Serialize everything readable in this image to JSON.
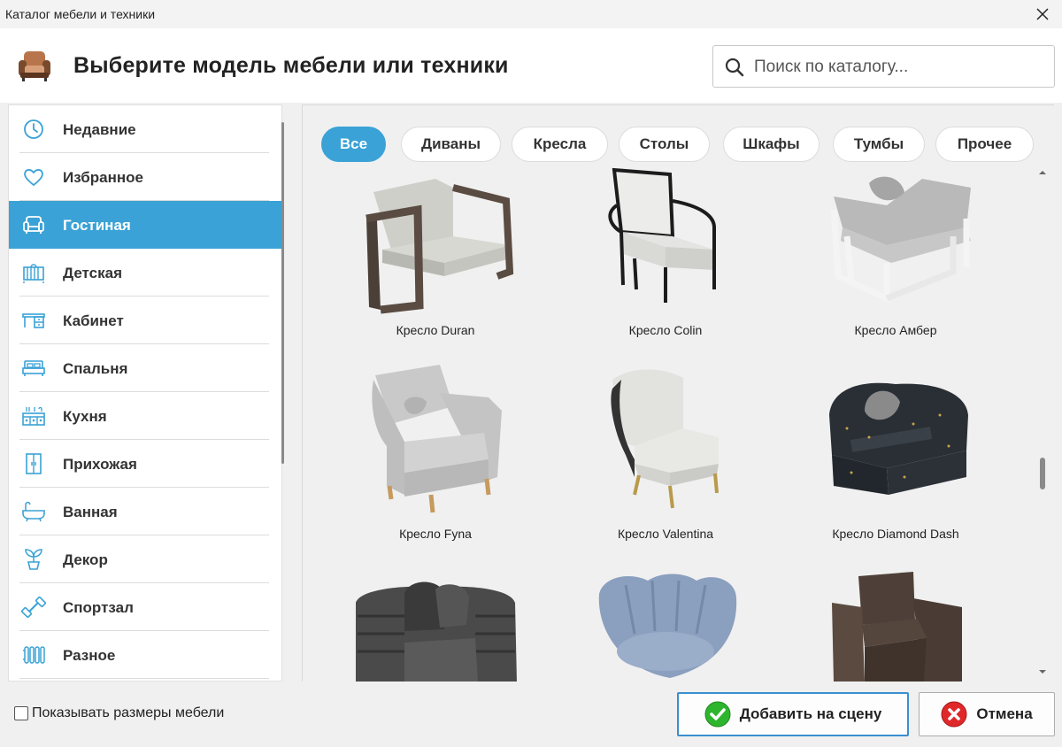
{
  "window": {
    "title": "Каталог мебели и техники"
  },
  "header": {
    "heading": "Выберите модель мебели или техники"
  },
  "search": {
    "placeholder": "Поиск по каталогу..."
  },
  "sidebar": {
    "items": [
      {
        "label": "Недавние",
        "icon": "clock-icon"
      },
      {
        "label": "Избранное",
        "icon": "heart-icon"
      },
      {
        "label": "Гостиная",
        "icon": "sofa-icon",
        "active": true
      },
      {
        "label": "Детская",
        "icon": "crib-icon"
      },
      {
        "label": "Кабинет",
        "icon": "desk-icon"
      },
      {
        "label": "Спальня",
        "icon": "bed-icon"
      },
      {
        "label": "Кухня",
        "icon": "kitchen-icon"
      },
      {
        "label": "Прихожая",
        "icon": "wardrobe-icon"
      },
      {
        "label": "Ванная",
        "icon": "bathtub-icon"
      },
      {
        "label": "Декор",
        "icon": "plant-icon"
      },
      {
        "label": "Спортзал",
        "icon": "dumbbell-icon"
      },
      {
        "label": "Разное",
        "icon": "radiator-icon"
      }
    ]
  },
  "filters": [
    {
      "label": "Все",
      "active": true
    },
    {
      "label": "Диваны"
    },
    {
      "label": "Кресла"
    },
    {
      "label": "Столы"
    },
    {
      "label": "Шкафы"
    },
    {
      "label": "Тумбы"
    },
    {
      "label": "Прочее"
    }
  ],
  "items": [
    {
      "name": "Кресло Duran"
    },
    {
      "name": "Кресло Colin"
    },
    {
      "name": "Кресло Амбер"
    },
    {
      "name": "Кресло Fyna"
    },
    {
      "name": "Кресло Valentina"
    },
    {
      "name": "Кресло Diamond Dash"
    },
    {
      "name": ""
    },
    {
      "name": ""
    },
    {
      "name": ""
    }
  ],
  "footer": {
    "show_sizes_label": "Показывать размеры мебели",
    "add_label": "Добавить на сцену",
    "cancel_label": "Отмена"
  },
  "colors": {
    "accent": "#3aa2d6",
    "ok": "#2eb52e",
    "cancel": "#e0282a"
  }
}
